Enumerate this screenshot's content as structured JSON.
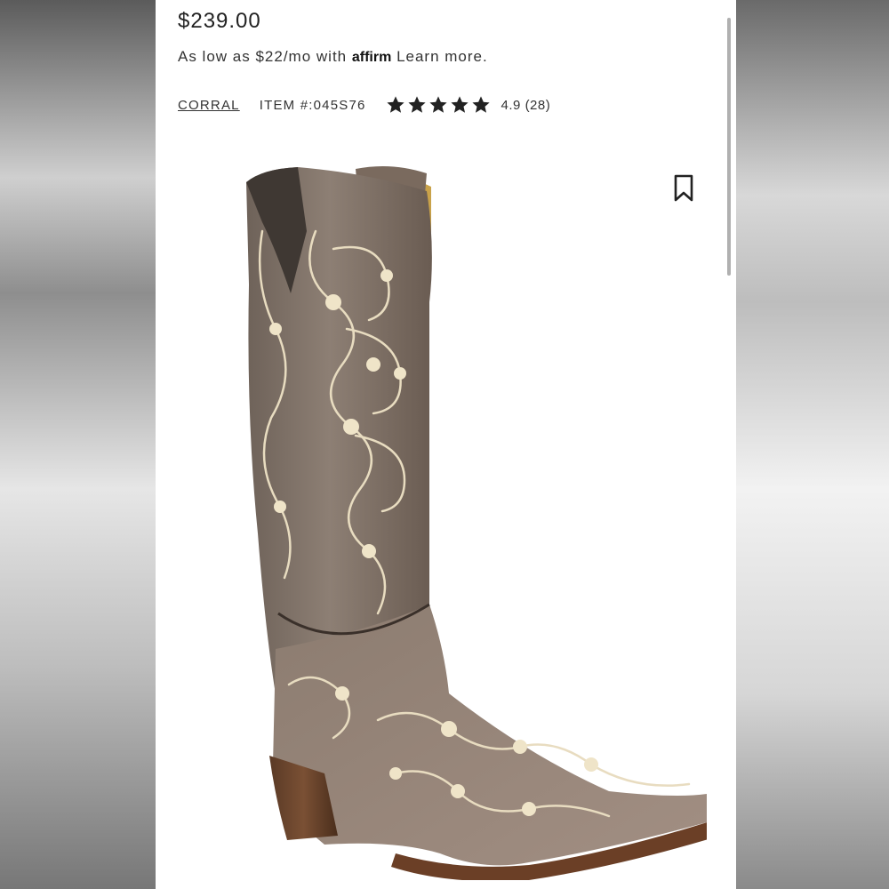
{
  "product": {
    "price": "$239.00",
    "financing": {
      "prefix": "As low as $22/mo with",
      "provider_logo": "affirm",
      "link_label": "Learn more."
    },
    "brand": "CORRAL",
    "item_number": "ITEM #:045S76",
    "rating": {
      "stars": 5,
      "label": "4.9 (28)"
    },
    "image_icon": "cowboy-boot-photo"
  },
  "icons": {
    "bookmark": "bookmark-icon",
    "star": "star-icon"
  },
  "colors": {
    "text": "#222222",
    "star": "#222222",
    "background": "#ffffff"
  }
}
